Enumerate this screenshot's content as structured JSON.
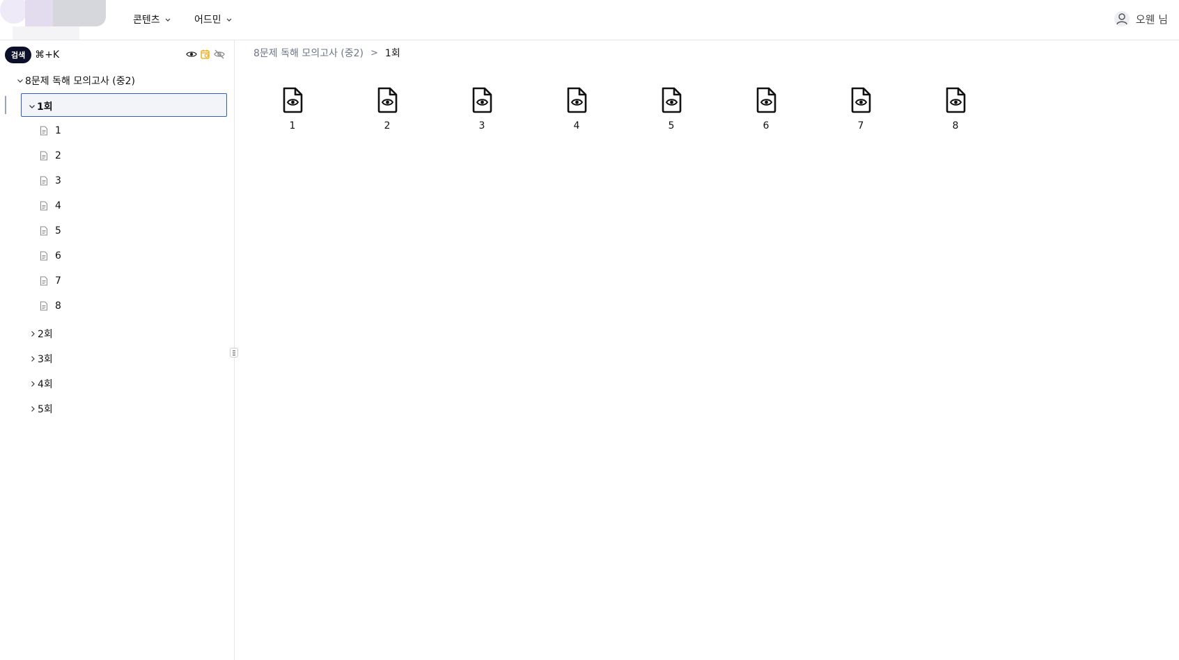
{
  "header": {
    "nav": [
      {
        "label": "콘텐츠"
      },
      {
        "label": "어드민"
      }
    ],
    "user_name": "오웬 님"
  },
  "sidebar": {
    "search_label": "검색",
    "search_shortcut": "⌘+K",
    "tree": {
      "root_label": "8문제 독해 모의고사 (중2)",
      "selected_folder": "1회",
      "files": [
        "1",
        "2",
        "3",
        "4",
        "5",
        "6",
        "7",
        "8"
      ],
      "collapsed_folders": [
        "2회",
        "3회",
        "4회",
        "5회"
      ]
    },
    "icon_colors": {
      "visible": "#222222",
      "scheduled": "#f2a400",
      "hidden": "#8a8a8a"
    }
  },
  "breadcrumb": {
    "parent": "8문제 독해 모의고사 (중2)",
    "separator": ">",
    "current": "1회"
  },
  "main": {
    "items": [
      {
        "label": "1"
      },
      {
        "label": "2"
      },
      {
        "label": "3"
      },
      {
        "label": "4"
      },
      {
        "label": "5"
      },
      {
        "label": "6"
      },
      {
        "label": "7"
      },
      {
        "label": "8"
      }
    ]
  }
}
